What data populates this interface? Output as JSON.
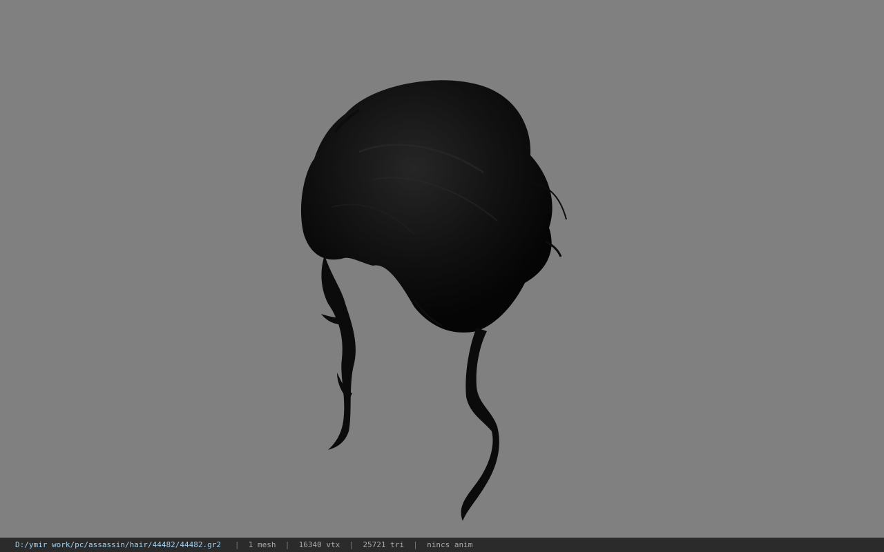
{
  "viewer": {
    "background_color": "#808080",
    "model_color": "#0d0d0d",
    "model_icon": "hair-mesh-icon"
  },
  "status": {
    "path": "D:/ymir work/pc/assassin/hair/44482/44482.gr2",
    "separator": "|",
    "mesh": "1 mesh",
    "vtx": "16340 vtx",
    "tri": "25721 tri",
    "anim": "nincs anim"
  }
}
